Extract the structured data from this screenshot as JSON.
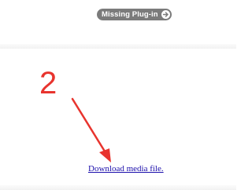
{
  "plugin_notice": {
    "label": "Missing Plug-in",
    "icon": "arrow-right-circle-icon"
  },
  "annotation": {
    "step_number": "2",
    "color": "#e8342e",
    "icon": "arrow-pointer-icon"
  },
  "download": {
    "link_text": "Download media file.",
    "link_color": "#1a0dab"
  }
}
